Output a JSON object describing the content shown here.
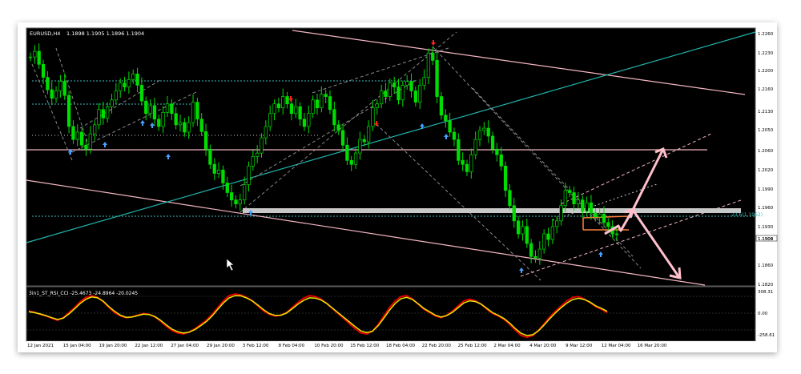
{
  "header": {
    "symbol": "EURUSD,H4",
    "ohlc": "1.1898 1.1905 1.1896 1.1904"
  },
  "indicator": {
    "label": "3in1_ST_RSI_CCI -25.4673 -24.8964 -20.0245"
  },
  "fib_label": "23.6(1.1962)",
  "current_price": "1.1904",
  "colors": {
    "background": "#000000",
    "candle": "#00dd00",
    "cyan_line": "#20b2aa",
    "pink_line": "#f4b6c2",
    "support_bar": "#c8c8c8",
    "rsi_red": "#e00000",
    "rsi_yellow": "#e8e800",
    "arrow_up": "#4aa0ff",
    "arrow_down": "#ff2020",
    "projection": "#ffc0cb",
    "orange": "#ff7f3a"
  },
  "chart_data": {
    "type": "line",
    "subtype": "candlestick",
    "price_axis": [
      "1.2260",
      "1.2230",
      "1.2200",
      "1.2160",
      "1.2130",
      "1.2050",
      "1.2060",
      "1.2020",
      "1.1990",
      "1.1960",
      "1.1930",
      "1.1900",
      "1.1860",
      "1.1820"
    ],
    "time_axis": [
      "12 Jan 2021",
      "15 Jan 04:00",
      "19 Jan 20:00",
      "22 Jan 12:00",
      "27 Jan 04:00",
      "29 Jan 20:00",
      "3 Feb 12:00",
      "8 Feb 04:00",
      "10 Feb 20:00",
      "15 Feb 12:00",
      "18 Feb 04:00",
      "22 Feb 20:00",
      "25 Feb 12:00",
      "2 Mar 04:00",
      "4 Mar 20:00",
      "9 Mar 12:00",
      "12 Mar 04:00",
      "16 Mar 20:00"
    ],
    "indicator_axis": [
      "308.31",
      "0.00",
      "-258.61"
    ],
    "ylim": [
      1.182,
      1.2265
    ],
    "series": [
      {
        "values": [
          1.2218,
          1.2228,
          1.2205,
          1.2182,
          1.216,
          1.2145,
          1.2158,
          1.2175,
          1.215,
          1.2095,
          1.2072,
          1.2085,
          1.2062,
          1.2055,
          1.2082,
          1.2098,
          1.2125,
          1.211,
          1.213,
          1.2142,
          1.2158,
          1.2172,
          1.2165,
          1.2178,
          1.2188,
          1.2168,
          1.214,
          1.2118,
          1.2132,
          1.2108,
          1.2095,
          1.212,
          1.2135,
          1.2118,
          1.2098,
          1.2102,
          1.2085,
          1.2102,
          1.2138,
          1.2108,
          1.2086,
          1.2055,
          1.2028,
          1.2012,
          1.2018,
          1.1995,
          1.1978,
          1.1965,
          1.1958,
          1.1965,
          1.1992,
          1.2025,
          1.2042,
          1.2048,
          1.2075,
          1.2095,
          1.2118,
          1.2135,
          1.2128,
          1.2148,
          1.2135,
          1.2118,
          1.213,
          1.2108,
          1.2095,
          1.2118,
          1.2142,
          1.2128,
          1.2152,
          1.2148,
          1.2125,
          1.2098,
          1.2088,
          1.2062,
          1.2035,
          1.2028,
          1.2048,
          1.2072,
          1.2068,
          1.2095,
          1.2128,
          1.2135,
          1.2158,
          1.2148,
          1.2172,
          1.2165,
          1.2142,
          1.2168,
          1.2175,
          1.2158,
          1.2138,
          1.2168,
          1.2182,
          1.2225,
          1.2212,
          1.2148,
          1.2115,
          1.2105,
          1.2085,
          1.2072,
          1.2035,
          1.2028,
          1.2015,
          1.2045,
          1.2072,
          1.2088,
          1.2092,
          1.2078,
          1.2055,
          1.2045,
          1.2025,
          1.1982,
          1.1955,
          1.1928,
          1.1905,
          1.1918,
          1.1888,
          1.1865,
          1.1862,
          1.1878,
          1.1905,
          1.1895,
          1.1918,
          1.1928,
          1.1955,
          1.1982,
          1.1978,
          1.1958,
          1.1965,
          1.1945,
          1.196,
          1.1942,
          1.1935,
          1.194,
          1.1925,
          1.1918,
          1.1905,
          1.1904
        ]
      },
      {
        "values": [
          60,
          45,
          20,
          0,
          -25,
          -50,
          -20,
          40,
          100,
          170,
          220,
          240,
          220,
          170,
          100,
          40,
          0,
          -20,
          -10,
          10,
          30,
          20,
          -10,
          -60,
          -120,
          -170,
          -200,
          -210,
          -190,
          -150,
          -100,
          -50,
          20,
          100,
          180,
          240,
          260,
          250,
          220,
          180,
          120,
          60,
          20,
          0,
          10,
          40,
          100,
          160,
          210,
          240,
          230,
          200,
          150,
          90,
          30,
          -30,
          -90,
          -150,
          -200,
          -210,
          -180,
          -100,
          0,
          100,
          180,
          230,
          240,
          200,
          140,
          80,
          40,
          0,
          -20,
          10,
          60,
          120,
          180,
          200,
          180,
          140,
          80,
          30,
          0,
          -40,
          -100,
          -170,
          -230,
          -250,
          -230,
          -170,
          -90,
          -10,
          60,
          120,
          180,
          220,
          230,
          200,
          160,
          110,
          80,
          40
        ]
      },
      {
        "values": [
          50,
          40,
          25,
          5,
          -20,
          -40,
          -25,
          25,
          85,
          150,
          200,
          225,
          215,
          175,
          110,
          55,
          10,
          -15,
          -12,
          5,
          22,
          18,
          -5,
          -50,
          -105,
          -155,
          -185,
          -200,
          -190,
          -160,
          -115,
          -65,
          0,
          80,
          155,
          215,
          240,
          238,
          215,
          180,
          130,
          75,
          30,
          8,
          10,
          35,
          85,
          140,
          185,
          215,
          212,
          190,
          150,
          95,
          40,
          -15,
          -70,
          -125,
          -175,
          -195,
          -180,
          -115,
          -25,
          70,
          150,
          205,
          220,
          195,
          145,
          90,
          50,
          10,
          -12,
          5,
          45,
          100,
          155,
          180,
          170,
          140,
          90,
          40,
          8,
          -30,
          -85,
          -150,
          -205,
          -230,
          -220,
          -175,
          -105,
          -30,
          40,
          100,
          155,
          195,
          210,
          195,
          165,
          120,
          90,
          55
        ]
      }
    ]
  }
}
